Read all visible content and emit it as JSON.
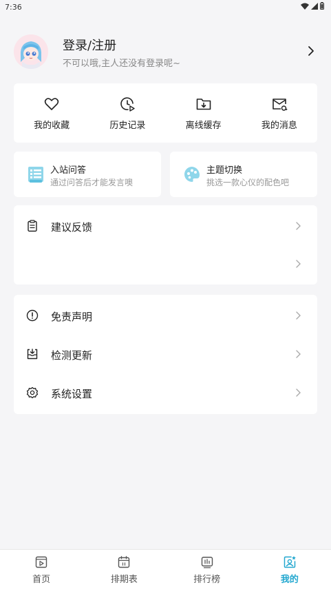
{
  "status": {
    "time": "7:36"
  },
  "profile": {
    "title": "登录/注册",
    "subtitle": "不可以哦,主人还没有登录呢~"
  },
  "quick_actions": [
    {
      "label": "我的收藏",
      "icon": "heart-icon"
    },
    {
      "label": "历史记录",
      "icon": "history-icon"
    },
    {
      "label": "离线缓存",
      "icon": "download-folder-icon"
    },
    {
      "label": "我的消息",
      "icon": "message-icon"
    }
  ],
  "features": [
    {
      "title": "入站问答",
      "subtitle": "通过问答后才能发言噢",
      "icon": "quiz-icon"
    },
    {
      "title": "主题切换",
      "subtitle": "挑选一款心仪的配色吧",
      "icon": "palette-icon"
    }
  ],
  "list_group_1": [
    {
      "label": "建议反馈",
      "icon": "clipboard-icon"
    },
    {
      "label": "",
      "icon": ""
    }
  ],
  "list_group_2": [
    {
      "label": "免责声明",
      "icon": "info-icon"
    },
    {
      "label": "检测更新",
      "icon": "update-icon"
    },
    {
      "label": "系统设置",
      "icon": "gear-icon"
    }
  ],
  "tabs": [
    {
      "label": "首页",
      "icon": "home-icon",
      "active": false
    },
    {
      "label": "排期表",
      "icon": "calendar-icon",
      "active": false
    },
    {
      "label": "排行榜",
      "icon": "ranking-icon",
      "active": false
    },
    {
      "label": "我的",
      "icon": "profile-icon",
      "active": true
    }
  ],
  "colors": {
    "accent": "#22a7cf",
    "background": "#f5f5f7",
    "card": "#ffffff"
  }
}
